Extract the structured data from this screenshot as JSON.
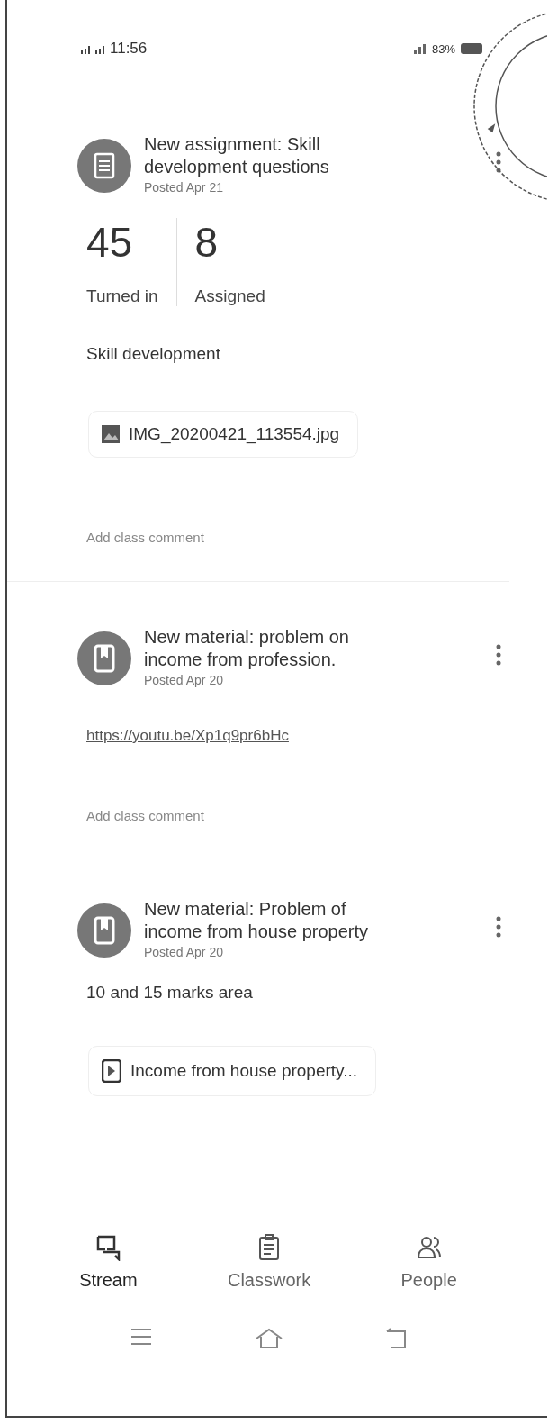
{
  "status_bar": {
    "time": "11:56",
    "battery": "83%"
  },
  "posts": [
    {
      "kind": "assignment",
      "title": "New assignment: Skill development questions",
      "posted": "Posted Apr 21",
      "stats": [
        {
          "count": "45",
          "label": "Turned in"
        },
        {
          "count": "8",
          "label": "Assigned"
        }
      ],
      "description": "Skill development",
      "attachment": {
        "kind": "image",
        "name": "IMG_20200421_113554.jpg"
      },
      "comment_placeholder": "Add class comment"
    },
    {
      "kind": "material",
      "title": "New material: problem on income from profession.",
      "posted": "Posted Apr 20",
      "link": "https://youtu.be/Xp1q9pr6bHc",
      "comment_placeholder": "Add class comment"
    },
    {
      "kind": "material",
      "title": "New material: Problem of income from house property",
      "posted": "Posted Apr 20",
      "description": "10 and 15 marks area",
      "attachment": {
        "kind": "video",
        "name": "Income from house property..."
      }
    }
  ],
  "bottom_nav": [
    {
      "kind": "stream",
      "label": "Stream",
      "selected": true
    },
    {
      "kind": "classwork",
      "label": "Classwork",
      "selected": false
    },
    {
      "kind": "people",
      "label": "People",
      "selected": false
    }
  ]
}
